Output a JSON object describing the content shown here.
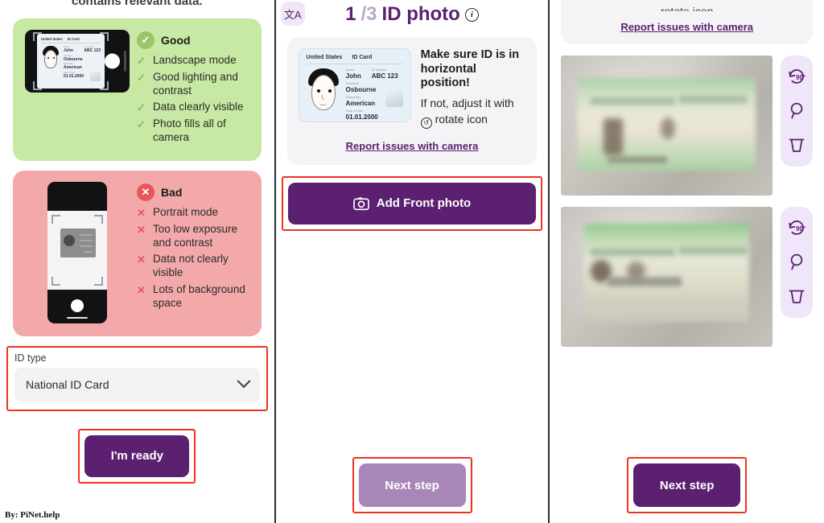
{
  "left": {
    "intro_text": "contains relevant data.",
    "good": {
      "title": "Good",
      "badge_icon": "check-icon",
      "items": [
        "Landscape mode",
        "Good lighting and contrast",
        "Data clearly visible",
        "Photo fills all of camera"
      ]
    },
    "bad": {
      "title": "Bad",
      "badge_icon": "cross-icon",
      "items": [
        "Portrait mode",
        "Too low exposure and contrast",
        "Data not clearly visible",
        "Lots of background space"
      ]
    },
    "id_card_art": {
      "country": "United States",
      "doc_type": "ID Card",
      "name_label": "Name",
      "name_value": "John",
      "idnum_label": "ID number",
      "idnum_value": "ABC 123",
      "surname_label": "Surname",
      "surname_value": "Osbourne",
      "nationality_label": "Nationality",
      "nationality_value": "American",
      "dob_label": "Date of birth",
      "dob_value": "01.01.2000"
    },
    "id_type": {
      "label": "ID type",
      "value": "National ID Card",
      "chevron_icon": "chevron-down-icon"
    },
    "ready_button": "I'm ready",
    "attribution": "By: PiNet.help"
  },
  "middle": {
    "translate_icon": "translate-icon",
    "translate_glyph": "文A",
    "step_current": "1",
    "step_total": "/3",
    "step_title": "ID photo",
    "info_icon": "info-icon",
    "instruction_strong": "Make sure ID is in horizontal position!",
    "instruction_soft_line1": "If not, adjust it with",
    "instruction_soft_line2": "rotate icon",
    "rotate_icon": "rotate-icon",
    "report_link": "Report issues with camera",
    "add_photo_button": "Add Front photo",
    "camera_icon": "camera-icon",
    "next_button": "Next step",
    "id_card_art": {
      "country": "United States",
      "doc_type": "ID Card",
      "name_label": "Name",
      "name_value": "John",
      "idnum_label": "ID number",
      "idnum_value": "ABC 123",
      "surname_label": "Surname",
      "surname_value": "Osbourne",
      "nationality_label": "Nationality",
      "nationality_value": "American",
      "dob_label": "Date of birth",
      "dob_value": "01.01.2000"
    }
  },
  "right": {
    "cut_text": "rotate icon",
    "report_link": "Report issues with camera",
    "photos": [
      {
        "name": "front-photo-thumbnail"
      },
      {
        "name": "back-photo-thumbnail"
      }
    ],
    "tools": [
      {
        "icon": "rotate-90-icon",
        "label": "90°"
      },
      {
        "icon": "magnify-icon",
        "label": ""
      },
      {
        "icon": "trash-icon",
        "label": ""
      }
    ],
    "next_button": "Next step"
  },
  "colors": {
    "primary": "#5b2070",
    "primary_disabled": "#a886b8",
    "good_bg": "#c7e9a3",
    "bad_bg": "#f3a9a9",
    "good_badge": "#9cc46a",
    "bad_badge": "#e8565c",
    "highlight_outline": "#ee3322",
    "tool_bg": "#efe6f9"
  }
}
